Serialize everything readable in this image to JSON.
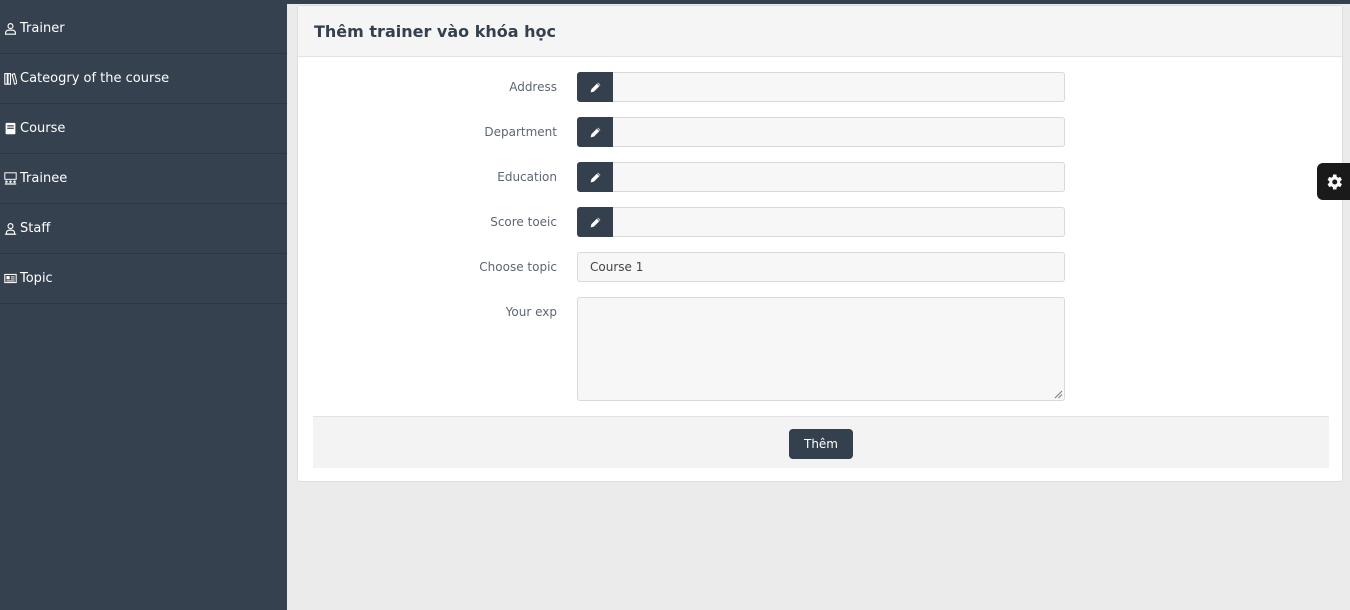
{
  "sidebar": {
    "items": [
      {
        "label": "Trainer",
        "icon": "user-icon"
      },
      {
        "label": "Cateogry of the course",
        "icon": "books-icon"
      },
      {
        "label": "Course",
        "icon": "book-icon"
      },
      {
        "label": "Trainee",
        "icon": "classroom-icon"
      },
      {
        "label": "Staff",
        "icon": "staff-icon"
      },
      {
        "label": "Topic",
        "icon": "newspaper-icon"
      }
    ]
  },
  "form": {
    "title": "Thêm trainer vào khóa học",
    "fields": {
      "address": {
        "label": "Address",
        "value": ""
      },
      "department": {
        "label": "Department",
        "value": ""
      },
      "education": {
        "label": "Education",
        "value": ""
      },
      "score_toeic": {
        "label": "Score toeic",
        "value": ""
      },
      "choose_topic": {
        "label": "Choose topic",
        "selected": "Course 1"
      },
      "your_exp": {
        "label": "Your exp",
        "value": ""
      }
    },
    "submit_label": "Thêm"
  },
  "colors": {
    "sidebar_bg": "#35414e",
    "accent": "#34404d",
    "page_bg": "#ebebeb"
  }
}
